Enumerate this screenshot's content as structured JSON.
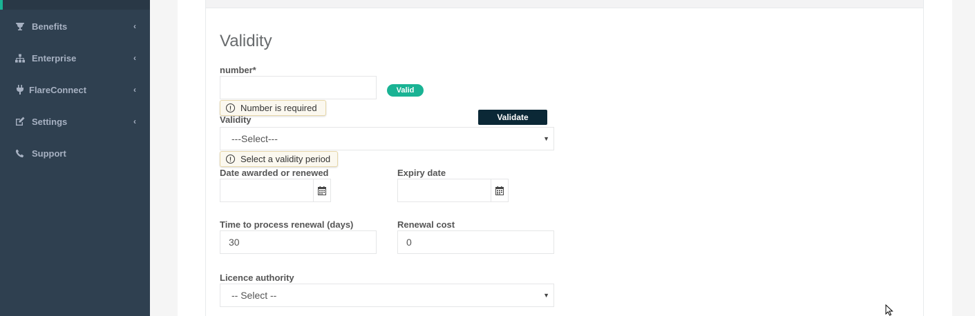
{
  "sidebar": {
    "items": [
      {
        "label": "Benefits",
        "icon": "trophy-icon",
        "has_chevron": true
      },
      {
        "label": "Enterprise",
        "icon": "sitemap-icon",
        "has_chevron": true
      },
      {
        "label": "FlareConnect",
        "icon": "plug-icon",
        "has_chevron": true
      },
      {
        "label": "Settings",
        "icon": "edit-icon",
        "has_chevron": true
      },
      {
        "label": "Support",
        "icon": "phone-icon",
        "has_chevron": false
      }
    ],
    "chevron_glyph": "‹"
  },
  "form": {
    "title": "Validity",
    "number": {
      "label": "number*",
      "value": "",
      "badge": "Valid",
      "error": "Number is required"
    },
    "validate_button": "Validate",
    "validity": {
      "label": "Validity",
      "selected": "---Select---",
      "error": "Select a validity period"
    },
    "date_awarded": {
      "label": "Date awarded or renewed",
      "value": ""
    },
    "expiry_date": {
      "label": "Expiry date",
      "value": ""
    },
    "time_to_process": {
      "label": "Time to process renewal (days)",
      "value": "30"
    },
    "renewal_cost": {
      "label": "Renewal cost",
      "value": "0"
    },
    "licence_authority": {
      "label": "Licence authority",
      "selected": "-- Select --"
    },
    "error_glyph": "!",
    "caret_glyph": "▼"
  },
  "colors": {
    "sidebar_bg": "#2f4050",
    "sidebar_text": "#a7b1c2",
    "badge_green": "#1ab394",
    "button_dark": "#0b2836"
  }
}
